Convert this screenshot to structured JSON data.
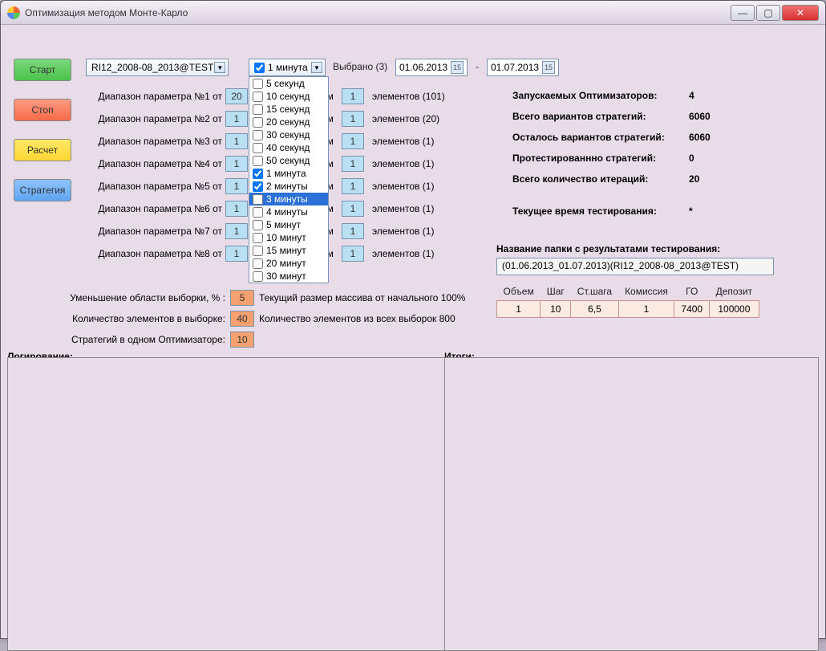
{
  "window": {
    "title": "Оптимизация методом Монте-Карло"
  },
  "buttons": {
    "start": "Старт",
    "stop": "Стоп",
    "calc": "Расчет",
    "strategy": "Стратегия"
  },
  "instrument_combo": "RI12_2008-08_2013@TEST",
  "timeframe_combo": "1 минута",
  "selected_label": "Выбрано (3)",
  "date_from": "01.06.2013",
  "date_to": "01.07.2013",
  "date_sep": "-",
  "params": [
    {
      "label": "Диапазон параметра №1 от",
      "from": "20",
      "step": "1",
      "elements": "элементов (101)"
    },
    {
      "label": "Диапазон параметра №2 от",
      "from": "1",
      "step": "1",
      "elements": "элементов (20)"
    },
    {
      "label": "Диапазон параметра №3 от",
      "from": "1",
      "step": "1",
      "elements": "элементов (1)"
    },
    {
      "label": "Диапазон параметра №4 от",
      "from": "1",
      "step": "1",
      "elements": "элементов (1)"
    },
    {
      "label": "Диапазон параметра №5 от",
      "from": "1",
      "step": "1",
      "elements": "элементов (1)"
    },
    {
      "label": "Диапазон параметра №6 от",
      "from": "1",
      "step": "1",
      "elements": "элементов (1)"
    },
    {
      "label": "Диапазон параметра №7 от",
      "from": "1",
      "step": "1",
      "elements": "элементов (1)"
    },
    {
      "label": "Диапазон параметра №8 от",
      "from": "1",
      "step": "1",
      "elements": "элементов (1)"
    }
  ],
  "param_mid": "ом",
  "low": {
    "reduce_label": "Уменьшение области выборки, % :",
    "reduce_val": "5",
    "reduce_after": "Текущий размер массива от начального 100%",
    "count_label": "Количество элементов в выборке:",
    "count_val": "40",
    "count_after": "Количество элементов из всех выборок 800",
    "strat_label": "Стратегий в одном Оптимизаторе:",
    "strat_val": "10"
  },
  "stats": [
    {
      "k": "Запускаемых Оптимизаторов:",
      "v": "4"
    },
    {
      "k": "Всего вариантов стратегий:",
      "v": "6060"
    },
    {
      "k": "Осталось вариантов стратегий:",
      "v": "6060"
    },
    {
      "k": "Протестированнно стратегий:",
      "v": "0"
    },
    {
      "k": "Всего количество итераций:",
      "v": "20"
    }
  ],
  "current_time": {
    "k": "Текущее время тестирования:",
    "v": "*"
  },
  "folder": {
    "label": "Название папки с результатами тестирования:",
    "value": "(01.06.2013_01.07.2013)(RI12_2008-08_2013@TEST)"
  },
  "table": {
    "headers": [
      "Объем",
      "Шаг",
      "Ст.шага",
      "Комиссия",
      "ГО",
      "Депозит"
    ],
    "row": [
      "1",
      "10",
      "6,5",
      "1",
      "7400",
      "100000"
    ]
  },
  "split": {
    "log": "Логирование:",
    "totals": "Итоги:"
  },
  "dropdown": {
    "items": [
      {
        "label": "5 секунд",
        "checked": false
      },
      {
        "label": "10 секунд",
        "checked": false
      },
      {
        "label": "15 секунд",
        "checked": false
      },
      {
        "label": "20 секунд",
        "checked": false
      },
      {
        "label": "30 секунд",
        "checked": false
      },
      {
        "label": "40 секунд",
        "checked": false
      },
      {
        "label": "50 секунд",
        "checked": false
      },
      {
        "label": "1 минута",
        "checked": true
      },
      {
        "label": "2 минуты",
        "checked": true
      },
      {
        "label": "3 минуты",
        "checked": false,
        "highlight": true
      },
      {
        "label": "4 минуты",
        "checked": false
      },
      {
        "label": "5 минут",
        "checked": false
      },
      {
        "label": "10 минут",
        "checked": false
      },
      {
        "label": "15 минут",
        "checked": false
      },
      {
        "label": "20 минут",
        "checked": false
      },
      {
        "label": "30 минут",
        "checked": false
      }
    ]
  }
}
